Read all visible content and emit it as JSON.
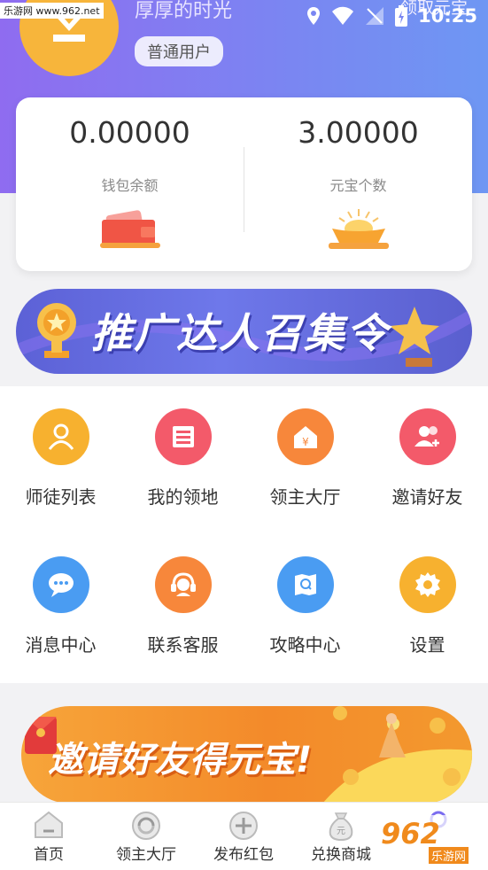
{
  "status_bar": {
    "watermark": "乐游网 www.962.net",
    "time": "10:25"
  },
  "header": {
    "username": "厚厚的时光",
    "user_badge": "普通用户",
    "top_right_link": "领取元宝"
  },
  "wallet": {
    "balance_value": "0.00000",
    "balance_label": "钱包余额",
    "ingot_value": "3.00000",
    "ingot_label": "元宝个数",
    "icons": [
      "wallet-icon",
      "gold-ingot-icon"
    ]
  },
  "promo_banner": {
    "text": "推广达人召集令"
  },
  "menu": {
    "items": [
      {
        "label": "师徒列表",
        "icon": "mentor-icon",
        "color": "#f7b12f"
      },
      {
        "label": "我的领地",
        "icon": "territory-icon",
        "color": "#f35a6a"
      },
      {
        "label": "领主大厅",
        "icon": "hall-icon",
        "color": "#f7873b"
      },
      {
        "label": "邀请好友",
        "icon": "invite-friend-icon",
        "color": "#f35a6a"
      },
      {
        "label": "消息中心",
        "icon": "message-icon",
        "color": "#4a9cf2"
      },
      {
        "label": "联系客服",
        "icon": "customer-service-icon",
        "color": "#f7873b"
      },
      {
        "label": "攻略中心",
        "icon": "guide-icon",
        "color": "#4a9cf2"
      },
      {
        "label": "设置",
        "icon": "settings-icon",
        "color": "#f7b12f"
      }
    ]
  },
  "invite_banner": {
    "text": "邀请好友得元宝!"
  },
  "bottom_nav": {
    "items": [
      {
        "label": "首页",
        "icon": "home-icon"
      },
      {
        "label": "领主大厅",
        "icon": "hall-icon"
      },
      {
        "label": "发布红包",
        "icon": "add-icon"
      },
      {
        "label": "兑换商城",
        "icon": "money-bag-icon"
      },
      {
        "label": "",
        "icon": "profile-icon"
      }
    ]
  },
  "watermark_br": {
    "big": "962",
    "small": "乐游网"
  }
}
